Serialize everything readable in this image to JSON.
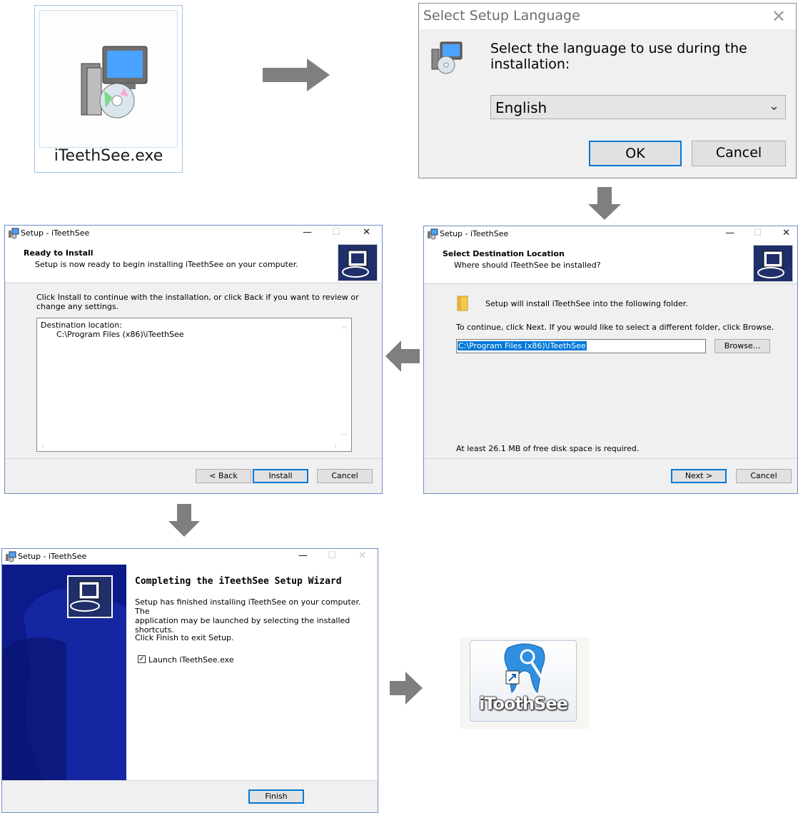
{
  "exe": {
    "label": "iTeethSee.exe",
    "icon": "installer-setup-icon"
  },
  "lang_dialog": {
    "title": "Select Setup Language",
    "prompt_line1": "Select the language to use during the",
    "prompt_line2": "installation:",
    "selected_language": "English",
    "ok_label": "OK",
    "cancel_label": "Cancel"
  },
  "dest_dialog": {
    "title": "Setup - iTeethSee",
    "header_title": "Select Destination Location",
    "header_sub": "Where should iTeethSee be installed?",
    "install_line": "Setup will install iTeethSee into the following folder.",
    "continue_line": "To continue, click Next. If you would like to select a different folder, click Browse.",
    "path_value": "C:\\Program Files (x86)\\iTeethSee",
    "browse_label": "Browse...",
    "space_line": "At least 26.1 MB of free disk space is required.",
    "next_label": "Next >",
    "cancel_label": "Cancel"
  },
  "ready_dialog": {
    "title": "Setup - iTeethSee",
    "header_title": "Ready to Install",
    "header_sub": "Setup is now ready to begin installing iTeethSee on your computer.",
    "info_line1": "Click Install to continue with the installation, or click Back if you want to review or",
    "info_line2": "change any settings.",
    "dest_label": "Destination location:",
    "dest_value": "C:\\Program Files (x86)\\iTeethSee",
    "back_label": "< Back",
    "install_label": "Install",
    "cancel_label": "Cancel"
  },
  "finish_dialog": {
    "title": "Setup - iTeethSee",
    "heading": "Completing the iTeethSee Setup Wizard",
    "body_line1": "Setup has finished installing iTeethSee on your computer. The",
    "body_line2": "application may be launched by selecting the installed",
    "body_line3": "shortcuts.",
    "exit_line": "Click Finish to exit Setup.",
    "launch_label": "Launch iTeethSee.exe",
    "launch_checked": true,
    "finish_label": "Finish"
  },
  "shortcut": {
    "label": "iToothSee",
    "icon": "tooth-app-icon"
  },
  "colors": {
    "accent": "#0078d7",
    "arrow": "#7f7f7f",
    "wizard_side": "#0c1a8a"
  }
}
